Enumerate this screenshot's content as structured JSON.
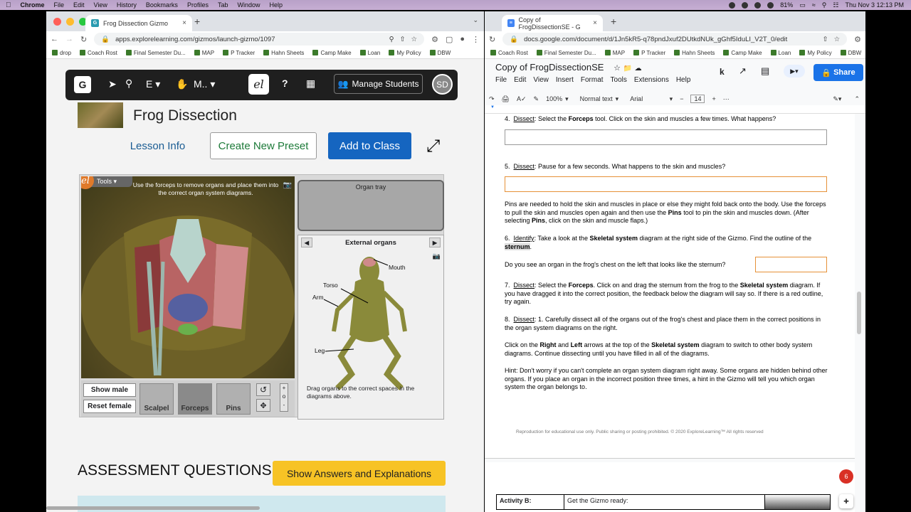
{
  "menubar": {
    "items": [
      "Chrome",
      "File",
      "Edit",
      "View",
      "History",
      "Bookmarks",
      "Profiles",
      "Tab",
      "Window",
      "Help"
    ],
    "battery": "81%",
    "clock": "Thu Nov 3  12:13 PM"
  },
  "left": {
    "tab_title": "Frog Dissection Gizmo",
    "url": "apps.explorelearning.com/gizmos/launch-gizmo/1097",
    "bookmarks": [
      "drop",
      "Coach Rost",
      "Final Semester Du...",
      "MAP",
      "P Tracker",
      "Hahn Sheets",
      "Camp Make",
      "Loan",
      "My Policy",
      "DBW"
    ],
    "toolbar": {
      "logo": "G",
      "menu1": "E",
      "menu2": "M..",
      "el": "el",
      "manage": "Manage Students",
      "avatar": "SD"
    },
    "title": "Frog Dissection",
    "lesson_info": "Lesson Info",
    "create_preset": "Create New Preset",
    "add_to_class": "Add to Class",
    "sim": {
      "tools_tag": "Tools",
      "instruction": "Use the forceps to remove organs and place them into the correct organ system diagrams.",
      "show_male": "Show male",
      "reset_female": "Reset female",
      "tools": [
        "Scalpel",
        "Forceps",
        "Pins"
      ],
      "organ_tray": "Organ tray",
      "diagram_title": "External organs",
      "labels": {
        "mouth": "Mouth",
        "torso": "Torso",
        "arm": "Arm",
        "leg": "Leg"
      },
      "drag_instruction": "Drag organs to the correct spaces in the diagrams above."
    },
    "assessment": "ASSESSMENT QUESTIONS",
    "show_answers": "Show Answers and Explanations"
  },
  "right": {
    "tab_title": "Copy of FrogDissectionSE - G",
    "url": "docs.google.com/document/d/1Jn5kR5-q78pndJxuf2DUtkdNUk_gGhf5IduLI_V2T_0/edit",
    "bookmarks": [
      "Coach Rost",
      "Final Semester Du...",
      "MAP",
      "P Tracker",
      "Hahn Sheets",
      "Camp Make",
      "Loan",
      "My Policy",
      "DBW"
    ],
    "doc_title": "Copy of FrogDissectionSE",
    "menu": [
      "File",
      "Edit",
      "View",
      "Insert",
      "Format",
      "Tools",
      "Extensions",
      "Help"
    ],
    "share": "Share",
    "format": {
      "zoom": "100%",
      "style": "Normal text",
      "font": "Arial",
      "size": "14"
    },
    "q4": {
      "num": "4.",
      "label": "Dissect",
      "text": ": Select the ",
      "bold": "Forceps",
      "rest": " tool. Click on the skin and muscles a few times. What happens?"
    },
    "q5": {
      "num": "5.",
      "label": "Dissect",
      "text": ": Pause for a few seconds. What happens to the skin and muscles?"
    },
    "pins_para": {
      "a": "Pins are needed to hold the skin and muscles in place or else they might fold back onto the body. Use the forceps to pull the skin and muscles open again and then use the ",
      "b": "Pins",
      "c": " tool to pin the skin and muscles down. (After selecting ",
      "d": "Pins",
      "e": ", click on the skin and muscle flaps.)"
    },
    "q6": {
      "num": "6.",
      "label": "Identify",
      "a": ": Take a look at the ",
      "b": "Skeletal system",
      "c": " diagram at the right side of the Gizmo. Find the outline of the ",
      "d": "sternum",
      "e": "."
    },
    "q6_question": "Do you see an organ in the frog's chest on the left that looks like the sternum?",
    "q7": {
      "num": "7.",
      "label": "Dissect",
      "a": ": Select the ",
      "b": "Forceps",
      "c": ". Click on and drag the sternum from the frog to the ",
      "d": "Skeletal system",
      "e": " diagram. If you have dragged it into the correct position, the feedback below the diagram will say so. If there is a red outline, try again."
    },
    "q8": {
      "num": "8.",
      "label": "Dissect",
      "text": ": 1.  Carefully dissect all of the organs out of the frog's chest and place them in the correct positions in the organ system diagrams on the right."
    },
    "arrows_para": {
      "a": "Click on the ",
      "b": "Right",
      "c": " and ",
      "d": "Left",
      "e": " arrows at the top of the ",
      "f": "Skeletal system",
      "g": " diagram to switch to other body system diagrams. Continue dissecting until you have filled in all of the diagrams."
    },
    "hint": "Hint: Don't worry if you can't complete an organ system diagram right away. Some organs are hidden behind other organs. If you place an organ in the incorrect position three times, a hint in the Gizmo will tell you which organ system the organ belongs to.",
    "footer": "Reproduction for educational use only. Public sharing or posting prohibited. © 2020 ExploreLearning™ All rights reserved",
    "activity_label": "Activity B:",
    "activity_text": "Get the Gizmo ready:",
    "notif_count": "6"
  }
}
